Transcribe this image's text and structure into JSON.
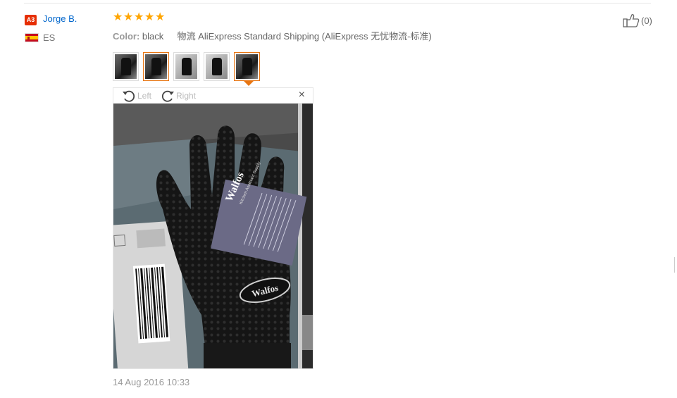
{
  "review": {
    "user": {
      "badge": "A3",
      "name": "Jorge B.",
      "country": "ES"
    },
    "rating_stars": 5,
    "color_label": "Color:",
    "color_value": "black",
    "shipping_label": "物流",
    "shipping_value": "AliExpress Standard Shipping (AliExpress 无忧物流-标准)",
    "likes": "(0)",
    "date": "14 Aug 2016 10:33"
  },
  "viewer": {
    "rotate_left": "Left",
    "rotate_right": "Right",
    "close": "×",
    "selected_index": 4
  },
  "photo": {
    "tag_brand": "Walfos",
    "tag_sub": "Kitchen Assistant Supply",
    "glove_brand": "Walfos"
  },
  "colors": {
    "accent": "#e87511",
    "link": "#0066cc",
    "star": "#ffa500",
    "badge": "#e62e04"
  }
}
